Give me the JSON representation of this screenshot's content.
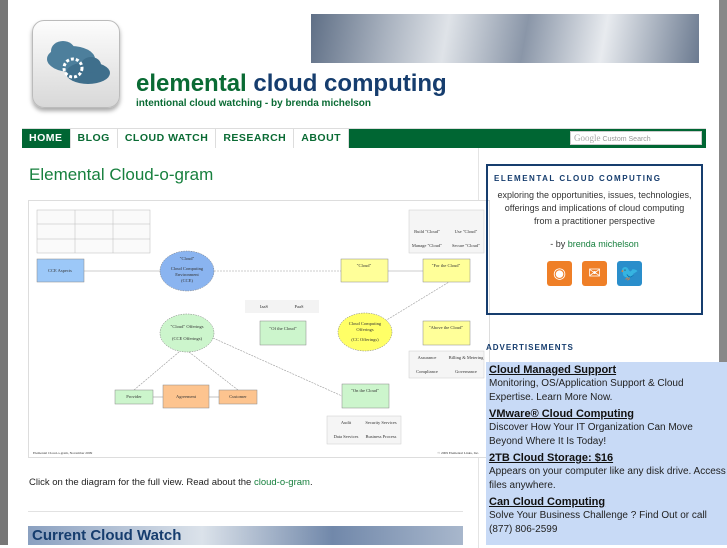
{
  "header": {
    "title_part1": "elemental",
    "title_part2": "cloud computing",
    "tagline": "intentional cloud watching - by brenda michelson"
  },
  "nav": {
    "items": [
      {
        "label": "HOME",
        "active": true
      },
      {
        "label": "BLOG"
      },
      {
        "label": "CLOUD WATCH"
      },
      {
        "label": "RESEARCH"
      },
      {
        "label": "ABOUT"
      }
    ],
    "search_brand": "Google",
    "search_placeholder": "Custom Search"
  },
  "main": {
    "title": "Elemental Cloud-o-gram",
    "diagram": {
      "cce_aspects": "CCE Aspects",
      "cce_line1": "\"Cloud\"",
      "cce_line2": "Cloud Computing",
      "cce_line3": "Environment",
      "cce_line4": "(CCE)",
      "cloud_box": "\"Cloud\"",
      "for_the_cloud": "\"For the Cloud\"",
      "cloud_offerings_1": "\"Cloud\" Offerings",
      "cloud_offerings_2": "(CCE Offerings)",
      "iaas": "IaaS",
      "paas": "PaaS",
      "of_the_cloud": "\"Of the Cloud\"",
      "cc_offerings_1": "Cloud Computing",
      "cc_offerings_2": "Offerings",
      "cc_offerings_3": "(CC Offerings)",
      "above_the_cloud": "\"Above the Cloud\"",
      "provider": "Provider",
      "agreement": "Agreement",
      "customer": "Customer",
      "on_the_cloud": "\"On the Cloud\"",
      "footer_left": "Elemental Cloud-o-gram, November 2009",
      "footer_right": "© 2009 Elemental Links, Inc.",
      "table_tr": [
        "Build \"Cloud\"",
        "Use \"Cloud\"",
        "Manage \"Cloud\"",
        "Secure \"Cloud\""
      ],
      "table_r": [
        "Assurance",
        "Billing & Metering",
        "Compliance",
        "Governance"
      ],
      "table_b": [
        "Audit",
        "Security Services",
        "Data Services",
        "Business Process"
      ]
    },
    "caption_text": "Click on the diagram for the full view.  Read about the ",
    "caption_link": "cloud-o-gram",
    "caption_end": ".",
    "section_title": "Current Cloud Watch"
  },
  "sidebar": {
    "box_title": "ELEMENTAL CLOUD COMPUTING",
    "description": "exploring the opportunities, issues, technologies, offerings and implications of cloud computing from a practitioner perspective",
    "by_prefix": "- by ",
    "author": "brenda michelson",
    "icons": [
      "rss-icon",
      "email-icon",
      "twitter-icon"
    ]
  },
  "ads": {
    "heading": "ADVERTISEMENTS",
    "items": [
      {
        "title": "Cloud Managed Support",
        "line1": "Monitoring, OS/Application Support & Cloud",
        "line2": "Expertise. Learn More Now."
      },
      {
        "title": "VMware® Cloud Computing",
        "line1": "Discover How Your IT Organization Can Move",
        "line2": "Beyond Where It Is Today!"
      },
      {
        "title": "2TB Cloud Storage: $16",
        "line1": "Appears on your computer like any disk drive. Access",
        "line2": "files anywhere."
      },
      {
        "title": "Can Cloud Computing",
        "line1": "Solve Your Business Challenge ? Find Out or call",
        "line2": "(877) 806-2599"
      }
    ]
  },
  "colors": {
    "brand_green": "#006633",
    "brand_blue": "#163d6e",
    "ad_bg": "#c8daf6"
  }
}
